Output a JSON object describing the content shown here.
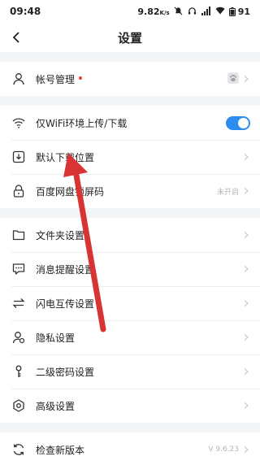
{
  "status_bar": {
    "time": "09:48",
    "network_speed": "9.82",
    "network_speed_unit": "K/s",
    "battery": "91"
  },
  "header": {
    "title": "设置"
  },
  "groups": [
    {
      "items": [
        {
          "label": "帐号管理",
          "icon": "person-icon",
          "badge": "red-dot",
          "right_icon": "paw-icon"
        }
      ]
    },
    {
      "items": [
        {
          "label": "仅WiFi环境上传/下载",
          "icon": "wifi-icon",
          "toggle": true
        },
        {
          "label": "默认下载位置",
          "icon": "download-icon"
        },
        {
          "label": "百度网盘锁屏码",
          "icon": "lock-icon",
          "value": "未开启"
        }
      ]
    },
    {
      "items": [
        {
          "label": "文件夹设置",
          "icon": "folder-icon"
        },
        {
          "label": "消息提醒设置",
          "icon": "message-icon"
        },
        {
          "label": "闪电互传设置",
          "icon": "transfer-icon"
        },
        {
          "label": "隐私设置",
          "icon": "privacy-icon"
        },
        {
          "label": "二级密码设置",
          "icon": "key-icon"
        },
        {
          "label": "高级设置",
          "icon": "gear-icon"
        }
      ]
    },
    {
      "items": [
        {
          "label": "检查新版本",
          "icon": "refresh-icon",
          "value": "V 9.6.23"
        }
      ]
    }
  ],
  "colors": {
    "accent": "#2d8cf0",
    "annotation_arrow": "#d93434",
    "badge": "#e53935"
  }
}
